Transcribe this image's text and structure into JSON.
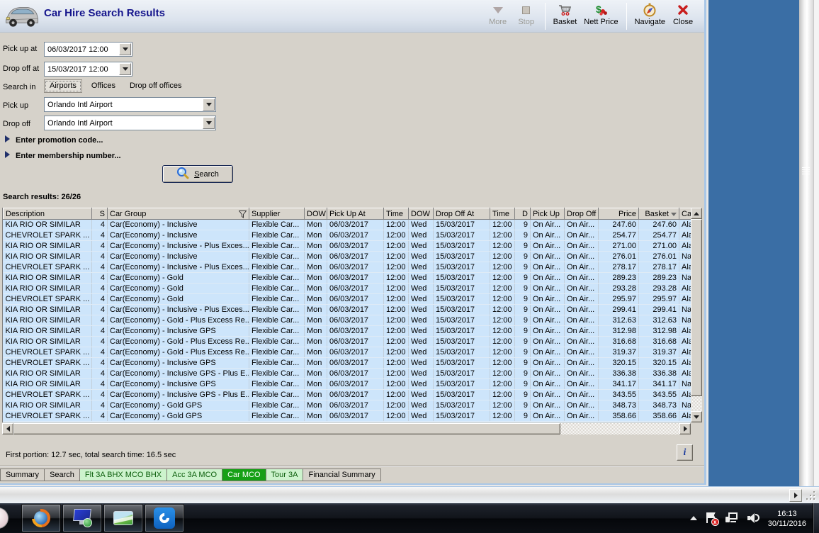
{
  "window": {
    "title": "Car Hire Search Results"
  },
  "toolbar": {
    "items": [
      {
        "label": "More",
        "disabled": true
      },
      {
        "label": "Stop",
        "disabled": true
      },
      {
        "label": "Basket",
        "disabled": false
      },
      {
        "label": "Nett Price",
        "disabled": false
      },
      {
        "label": "Navigate",
        "disabled": false
      },
      {
        "label": "Close",
        "disabled": false
      }
    ]
  },
  "form": {
    "pickup_at_label": "Pick up at",
    "pickup_at_value": "06/03/2017 12:00",
    "dropoff_at_label": "Drop off at",
    "dropoff_at_value": "15/03/2017 12:00",
    "search_in_label": "Search in",
    "search_in_options": [
      "Airports",
      "Offices",
      "Drop off offices"
    ],
    "search_in_selected": "Airports",
    "pickup_label": "Pick up",
    "pickup_value": "Orlando Intl Airport",
    "dropoff_label": "Drop off",
    "dropoff_value": "Orlando Intl Airport",
    "promotion_expander": "Enter promotion code...",
    "membership_expander": "Enter membership number...",
    "search_button_label": "Search"
  },
  "results": {
    "summary": "Search results: 26/26",
    "columns": [
      "Description",
      "S",
      "Car Group",
      "Supplier",
      "DOW",
      "Pick Up At",
      "Time",
      "DOW",
      "Drop Off At",
      "Time",
      "D",
      "Pick Up",
      "Drop Off",
      "Price",
      "Basket",
      "Ca"
    ],
    "filter_column": "Car Group",
    "sort_column": "Basket",
    "rows": [
      [
        "KIA RIO OR SIMILAR",
        "4",
        "Car(Economy) - Inclusive",
        "Flexible Car...",
        "Mon",
        "06/03/2017",
        "12:00",
        "Wed",
        "15/03/2017",
        "12:00",
        "9",
        "On Air...",
        "On Air...",
        "247.60",
        "247.60",
        "Ala"
      ],
      [
        "CHEVROLET SPARK ...",
        "4",
        "Car(Economy) - Inclusive",
        "Flexible Car...",
        "Mon",
        "06/03/2017",
        "12:00",
        "Wed",
        "15/03/2017",
        "12:00",
        "9",
        "On Air...",
        "On Air...",
        "254.77",
        "254.77",
        "Ala"
      ],
      [
        "KIA RIO OR SIMILAR",
        "4",
        "Car(Economy) - Inclusive - Plus Exces...",
        "Flexible Car...",
        "Mon",
        "06/03/2017",
        "12:00",
        "Wed",
        "15/03/2017",
        "12:00",
        "9",
        "On Air...",
        "On Air...",
        "271.00",
        "271.00",
        "Ala"
      ],
      [
        "KIA RIO OR SIMILAR",
        "4",
        "Car(Economy) - Inclusive",
        "Flexible Car...",
        "Mon",
        "06/03/2017",
        "12:00",
        "Wed",
        "15/03/2017",
        "12:00",
        "9",
        "On Air...",
        "On Air...",
        "276.01",
        "276.01",
        "Na"
      ],
      [
        "CHEVROLET SPARK ...",
        "4",
        "Car(Economy) - Inclusive - Plus Exces...",
        "Flexible Car...",
        "Mon",
        "06/03/2017",
        "12:00",
        "Wed",
        "15/03/2017",
        "12:00",
        "9",
        "On Air...",
        "On Air...",
        "278.17",
        "278.17",
        "Ala"
      ],
      [
        "KIA RIO OR SIMILAR",
        "4",
        "Car(Economy) - Gold",
        "Flexible Car...",
        "Mon",
        "06/03/2017",
        "12:00",
        "Wed",
        "15/03/2017",
        "12:00",
        "9",
        "On Air...",
        "On Air...",
        "289.23",
        "289.23",
        "Na"
      ],
      [
        "KIA RIO OR SIMILAR",
        "4",
        "Car(Economy) - Gold",
        "Flexible Car...",
        "Mon",
        "06/03/2017",
        "12:00",
        "Wed",
        "15/03/2017",
        "12:00",
        "9",
        "On Air...",
        "On Air...",
        "293.28",
        "293.28",
        "Ala"
      ],
      [
        "CHEVROLET SPARK ...",
        "4",
        "Car(Economy) - Gold",
        "Flexible Car...",
        "Mon",
        "06/03/2017",
        "12:00",
        "Wed",
        "15/03/2017",
        "12:00",
        "9",
        "On Air...",
        "On Air...",
        "295.97",
        "295.97",
        "Ala"
      ],
      [
        "KIA RIO OR SIMILAR",
        "4",
        "Car(Economy) - Inclusive - Plus Exces...",
        "Flexible Car...",
        "Mon",
        "06/03/2017",
        "12:00",
        "Wed",
        "15/03/2017",
        "12:00",
        "9",
        "On Air...",
        "On Air...",
        "299.41",
        "299.41",
        "Na"
      ],
      [
        "KIA RIO OR SIMILAR",
        "4",
        "Car(Economy) - Gold - Plus Excess Re...",
        "Flexible Car...",
        "Mon",
        "06/03/2017",
        "12:00",
        "Wed",
        "15/03/2017",
        "12:00",
        "9",
        "On Air...",
        "On Air...",
        "312.63",
        "312.63",
        "Na"
      ],
      [
        "KIA RIO OR SIMILAR",
        "4",
        "Car(Economy) - Inclusive GPS",
        "Flexible Car...",
        "Mon",
        "06/03/2017",
        "12:00",
        "Wed",
        "15/03/2017",
        "12:00",
        "9",
        "On Air...",
        "On Air...",
        "312.98",
        "312.98",
        "Ala"
      ],
      [
        "KIA RIO OR SIMILAR",
        "4",
        "Car(Economy) - Gold - Plus Excess Re...",
        "Flexible Car...",
        "Mon",
        "06/03/2017",
        "12:00",
        "Wed",
        "15/03/2017",
        "12:00",
        "9",
        "On Air...",
        "On Air...",
        "316.68",
        "316.68",
        "Ala"
      ],
      [
        "CHEVROLET SPARK ...",
        "4",
        "Car(Economy) - Gold - Plus Excess Re...",
        "Flexible Car...",
        "Mon",
        "06/03/2017",
        "12:00",
        "Wed",
        "15/03/2017",
        "12:00",
        "9",
        "On Air...",
        "On Air...",
        "319.37",
        "319.37",
        "Ala"
      ],
      [
        "CHEVROLET SPARK ...",
        "4",
        "Car(Economy) - Inclusive GPS",
        "Flexible Car...",
        "Mon",
        "06/03/2017",
        "12:00",
        "Wed",
        "15/03/2017",
        "12:00",
        "9",
        "On Air...",
        "On Air...",
        "320.15",
        "320.15",
        "Ala"
      ],
      [
        "KIA RIO OR SIMILAR",
        "4",
        "Car(Economy) - Inclusive GPS - Plus E...",
        "Flexible Car...",
        "Mon",
        "06/03/2017",
        "12:00",
        "Wed",
        "15/03/2017",
        "12:00",
        "9",
        "On Air...",
        "On Air...",
        "336.38",
        "336.38",
        "Ala"
      ],
      [
        "KIA RIO OR SIMILAR",
        "4",
        "Car(Economy) - Inclusive GPS",
        "Flexible Car...",
        "Mon",
        "06/03/2017",
        "12:00",
        "Wed",
        "15/03/2017",
        "12:00",
        "9",
        "On Air...",
        "On Air...",
        "341.17",
        "341.17",
        "Na"
      ],
      [
        "CHEVROLET SPARK ...",
        "4",
        "Car(Economy) - Inclusive GPS - Plus E...",
        "Flexible Car...",
        "Mon",
        "06/03/2017",
        "12:00",
        "Wed",
        "15/03/2017",
        "12:00",
        "9",
        "On Air...",
        "On Air...",
        "343.55",
        "343.55",
        "Ala"
      ],
      [
        "KIA RIO OR SIMILAR",
        "4",
        "Car(Economy) - Gold GPS",
        "Flexible Car...",
        "Mon",
        "06/03/2017",
        "12:00",
        "Wed",
        "15/03/2017",
        "12:00",
        "9",
        "On Air...",
        "On Air...",
        "348.73",
        "348.73",
        "Na"
      ],
      [
        "CHEVROLET SPARK ...",
        "4",
        "Car(Economy) - Gold GPS",
        "Flexible Car...",
        "Mon",
        "06/03/2017",
        "12:00",
        "Wed",
        "15/03/2017",
        "12:00",
        "9",
        "On Air...",
        "On Air...",
        "358.66",
        "358.66",
        "Ala"
      ]
    ]
  },
  "status": {
    "text": "First portion: 12.7 sec, total search time: 16.5 sec",
    "info_button_label": "i"
  },
  "bottom_tabs": [
    {
      "label": "Summary",
      "style": "plain"
    },
    {
      "label": "Search",
      "style": "plain"
    },
    {
      "label": "Flt 3A BHX MCO BHX",
      "style": "green"
    },
    {
      "label": "Acc 3A MCO",
      "style": "green"
    },
    {
      "label": "Car MCO",
      "style": "selected"
    },
    {
      "label": "Tour 3A",
      "style": "green"
    },
    {
      "label": "Financial Summary",
      "style": "plain"
    }
  ],
  "taskbar": {
    "time": "16:13",
    "date": "30/11/2016"
  }
}
